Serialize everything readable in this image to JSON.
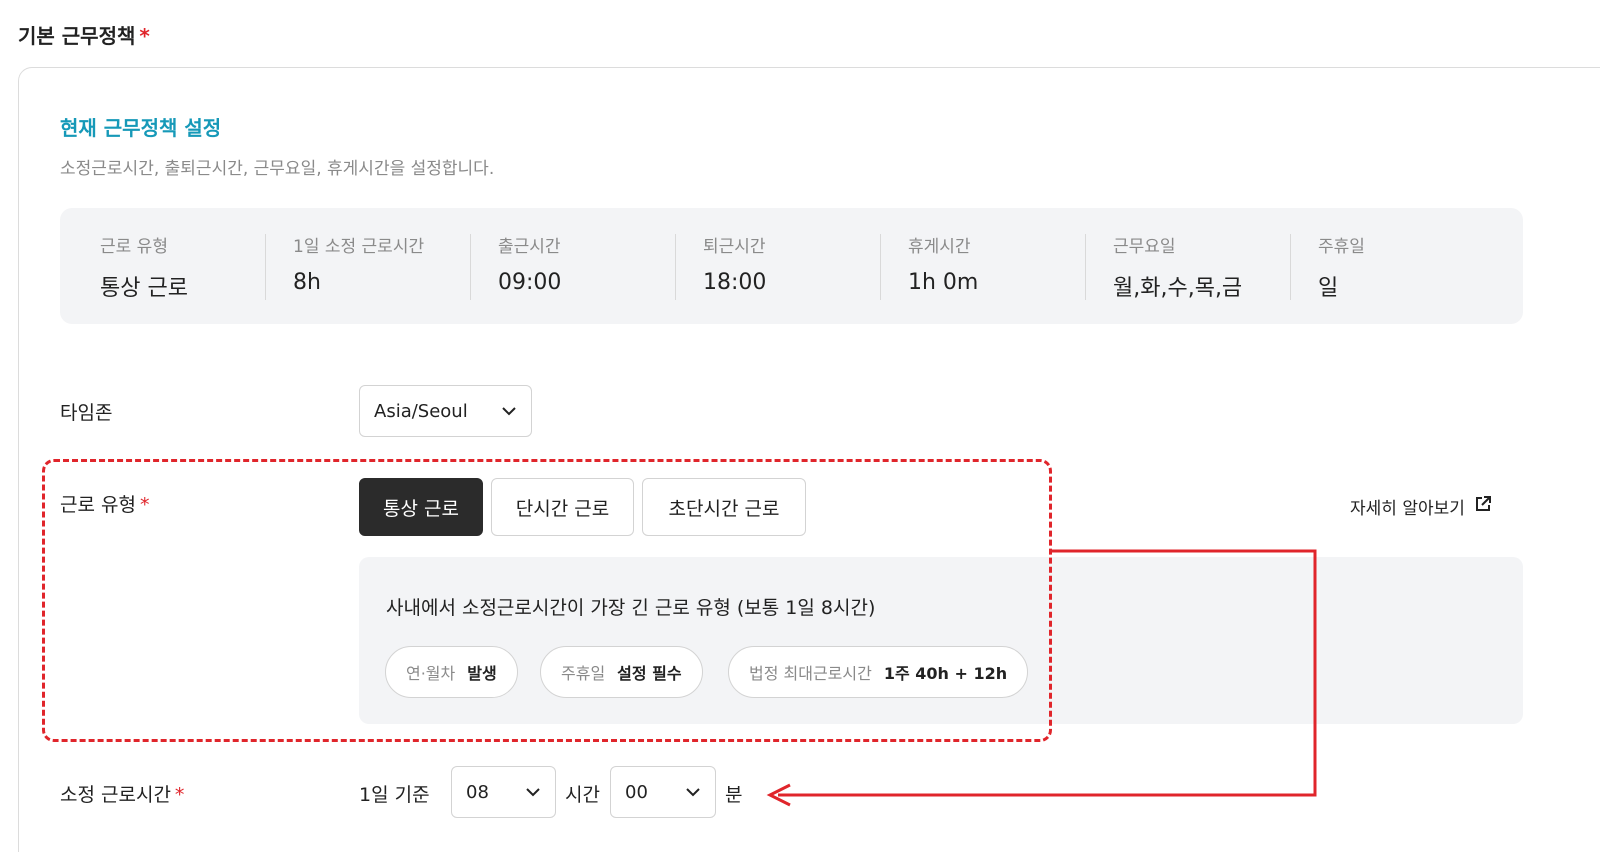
{
  "section": {
    "title": "기본 근무정책",
    "required_mark": "*"
  },
  "card": {
    "heading": "현재 근무정책 설정",
    "description": "소정근로시간, 출퇴근시간, 근무요일, 휴게시간을 설정합니다."
  },
  "summary": [
    {
      "label": "근로 유형",
      "value": "통상 근로"
    },
    {
      "label": "1일 소정 근로시간",
      "value": "8h"
    },
    {
      "label": "출근시간",
      "value": "09:00"
    },
    {
      "label": "퇴근시간",
      "value": "18:00"
    },
    {
      "label": "휴게시간",
      "value": "1h 0m"
    },
    {
      "label": "근무요일",
      "value": "월,화,수,목,금"
    },
    {
      "label": "주휴일",
      "value": "일"
    }
  ],
  "timezone": {
    "label": "타임존",
    "value": "Asia/Seoul"
  },
  "work_type": {
    "label": "근로 유형",
    "required_mark": "*",
    "options": [
      "통상 근로",
      "단시간 근로",
      "초단시간 근로"
    ],
    "selected": "통상 근로",
    "learn_more": "자세히 알아보기",
    "info_text": "사내에서 소정근로시간이 가장 긴 근로 유형 (보통 1일 8시간)",
    "chips": [
      {
        "key": "연·월차",
        "value": "발생"
      },
      {
        "key": "주휴일",
        "value": "설정 필수"
      },
      {
        "key": "법정 최대근로시간",
        "value": "1주 40h + 12h"
      }
    ]
  },
  "work_hours": {
    "label": "소정 근로시간",
    "required_mark": "*",
    "prefix": "1일 기준",
    "hours_value": "08",
    "hours_unit": "시간",
    "minutes_value": "00",
    "minutes_unit": "분"
  },
  "colors": {
    "accent": "#1699b8",
    "required": "#e0252b",
    "active_button": "#2b2b2b",
    "panel_bg": "#f3f4f6"
  },
  "icons": {
    "dropdown": "chevron-down-icon",
    "external_link": "external-link-icon"
  }
}
